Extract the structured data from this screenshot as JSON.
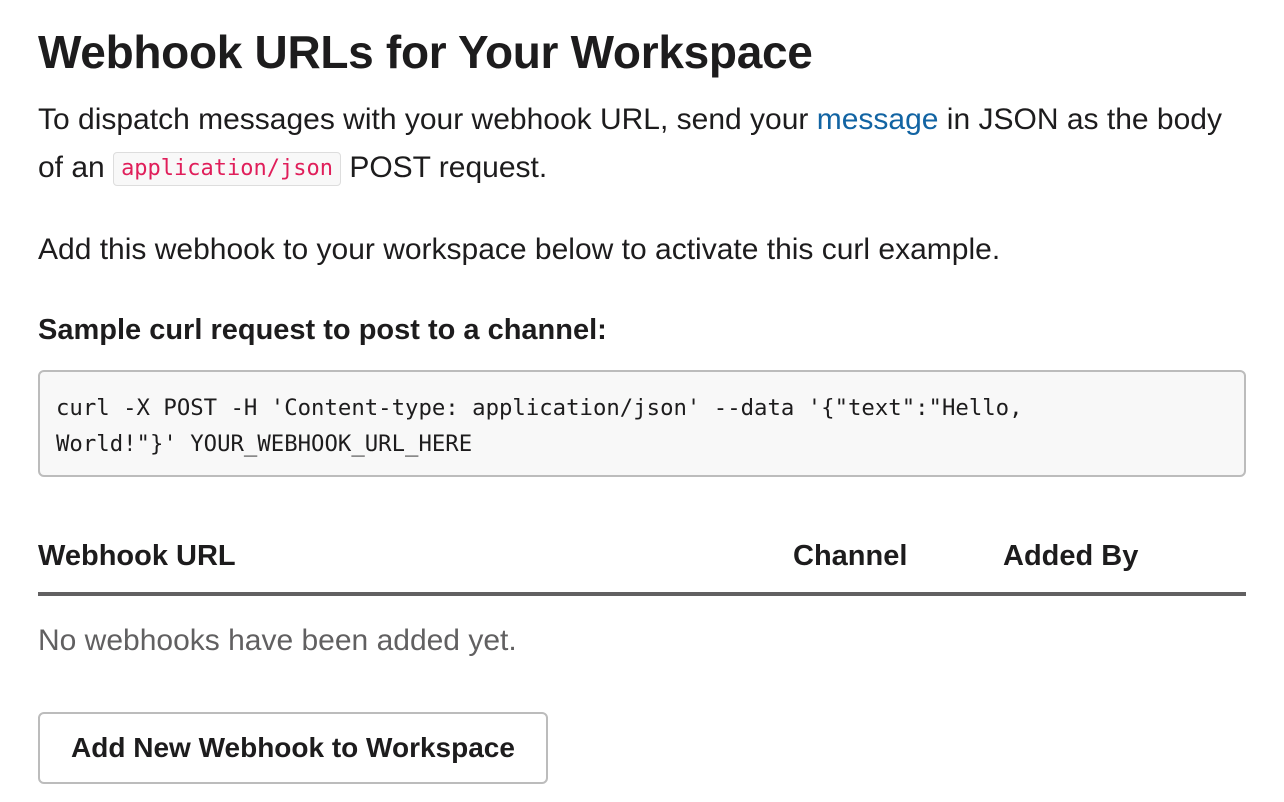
{
  "page": {
    "title": "Webhook URLs for Your Workspace"
  },
  "intro": {
    "part1": "To dispatch messages with your webhook URL, send your ",
    "link": "message",
    "part2": " in JSON as the body of an ",
    "code": "application/json",
    "part3": " POST request."
  },
  "activate_text": "Add this webhook to your workspace below to activate this curl example.",
  "sample": {
    "heading": "Sample curl request to post to a channel:",
    "line1": "curl -X POST -H 'Content-type: application/json' --data '{\"text\":\"Hello,",
    "line2": "World!\"}' YOUR_WEBHOOK_URL_HERE"
  },
  "table": {
    "headers": [
      "Webhook URL",
      "Channel",
      "Added By"
    ],
    "empty_message": "No webhooks have been added yet."
  },
  "add_button_label": "Add New Webhook to Workspace",
  "colors": {
    "link": "#1264a3",
    "inline_code": "#e01e5a",
    "text": "#1d1c1d",
    "muted": "#616061"
  }
}
